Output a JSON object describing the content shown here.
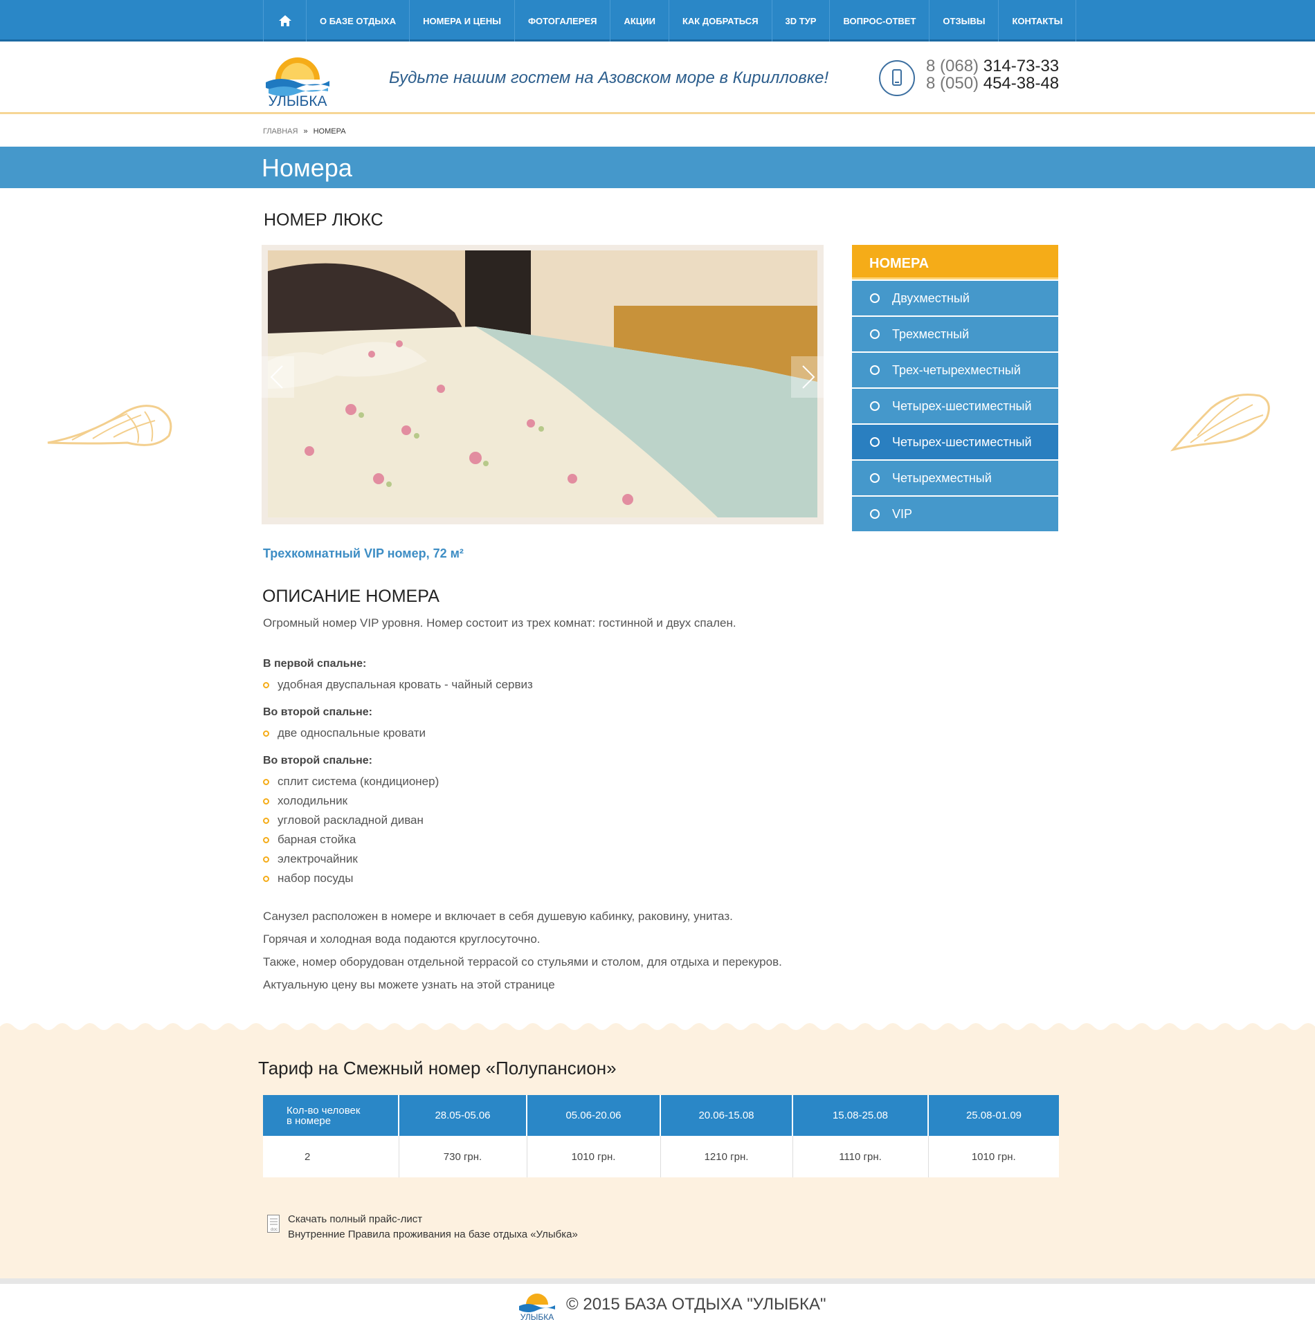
{
  "nav": {
    "items": [
      "О БАЗЕ ОТДЫХА",
      "НОМЕРА И ЦЕНЫ",
      "ФОТОГАЛЕРЕЯ",
      "АКЦИИ",
      "КАК ДОБРАТЬСЯ",
      "3D ТУР",
      "ВОПРОС-ОТВЕТ",
      "ОТЗЫВЫ",
      "КОНТАКТЫ"
    ]
  },
  "header": {
    "logo_text": "УЛЫБКА",
    "slogan": "Будьте нашим гостем на Азовском море в Кирилловке!",
    "phone1_code": "8 (068)",
    "phone1_num": "314-73-33",
    "phone2_code": "8 (050)",
    "phone2_num": "454-38-48"
  },
  "breadcrumb": {
    "home": "ГЛАВНАЯ",
    "sep": "»",
    "current": "НОМЕРА"
  },
  "page_title": "Номера",
  "room": {
    "title": "НОМЕР ЛЮКС",
    "subtitle": "Трехкомнатный VIP номер, 72 м²",
    "desc_heading": "ОПИСАНИЕ НОМЕРА",
    "intro": "Огромный номер VIP уровня. Номер состоит из трех комнат: гостинной и двух спален.",
    "group1_label": "В первой спальне:",
    "group1_items": [
      "удобная двуспальная кровать - чайный сервиз"
    ],
    "group2_label": "Во второй спальне:",
    "group2_items": [
      "две односпальные кровати"
    ],
    "group3_label": "Во второй спальне:",
    "group3_items": [
      "сплит система (кондиционер)",
      "холодильник",
      "угловой раскладной диван",
      "барная стойка",
      "электрочайник",
      "набор посуды"
    ],
    "outro": [
      "Санузел расположен в номере и включает в себя душевую кабинку, раковину, унитаз.",
      "Горячая и холодная вода подаются круглосуточно.",
      "Также, номер оборудован отдельной террасой со стульями и столом, для отдыха и перекуров.",
      "Актуальную цену вы можете узнать на этой странице"
    ]
  },
  "sidebar": {
    "heading": "НОМЕРА",
    "items": [
      "Двухместный",
      "Трехместный",
      "Трех-четырехместный",
      "Четырех-шестиместный",
      "Четырех-шестиместный",
      "Четырехместный",
      "VIP"
    ],
    "active_index": 4
  },
  "tariff": {
    "title": "Тариф на Смежный номер «Полупансион»",
    "head_first_l1": "Кол-во человек",
    "head_first_l2": "в номере",
    "periods": [
      "28.05-05.06",
      "05.06-20.06",
      "20.06-15.08",
      "15.08-25.08",
      "25.08-01.09"
    ],
    "row_people": "2",
    "row_prices": [
      "730 грн.",
      "1010 грн.",
      "1210 грн.",
      "1110 грн.",
      "1010 грн."
    ]
  },
  "doc_icon_label": "doc",
  "links": [
    "Скачать полный прайс-лист",
    "Внутренние Правила проживания на базе отдыха «Улыбка»"
  ],
  "footer": {
    "logo_text": "УЛЫБКА",
    "copyright": "© 2015 БАЗА ОТДЫХА \"УЛЫБКА\""
  },
  "colors": {
    "nav": "#2a87c7",
    "accent": "#f5ac18",
    "title_bar": "#4598cb",
    "sand": "#fdf1e0"
  }
}
